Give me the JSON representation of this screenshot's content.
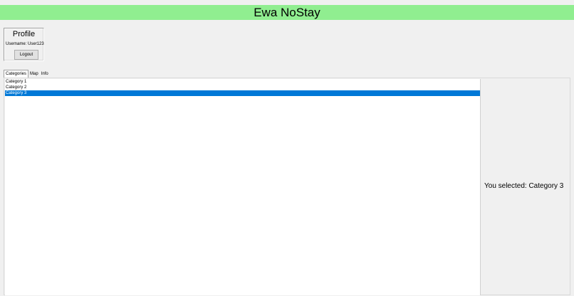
{
  "app": {
    "title": "Ewa NoStay",
    "title_bar_color": "#90ee90"
  },
  "profile": {
    "title": "Profile",
    "username_text": "Username: User123",
    "logout_label": "Logout"
  },
  "tabs": [
    {
      "label": "Categories",
      "active": true
    },
    {
      "label": "Map",
      "active": false
    },
    {
      "label": "Info",
      "active": false
    }
  ],
  "categories": {
    "items": [
      {
        "label": "Category 1",
        "selected": false
      },
      {
        "label": "Category 2",
        "selected": false
      },
      {
        "label": "Category 3",
        "selected": true
      }
    ],
    "selection_color": "#0078d7"
  },
  "selection_text": "You selected: Category 3"
}
